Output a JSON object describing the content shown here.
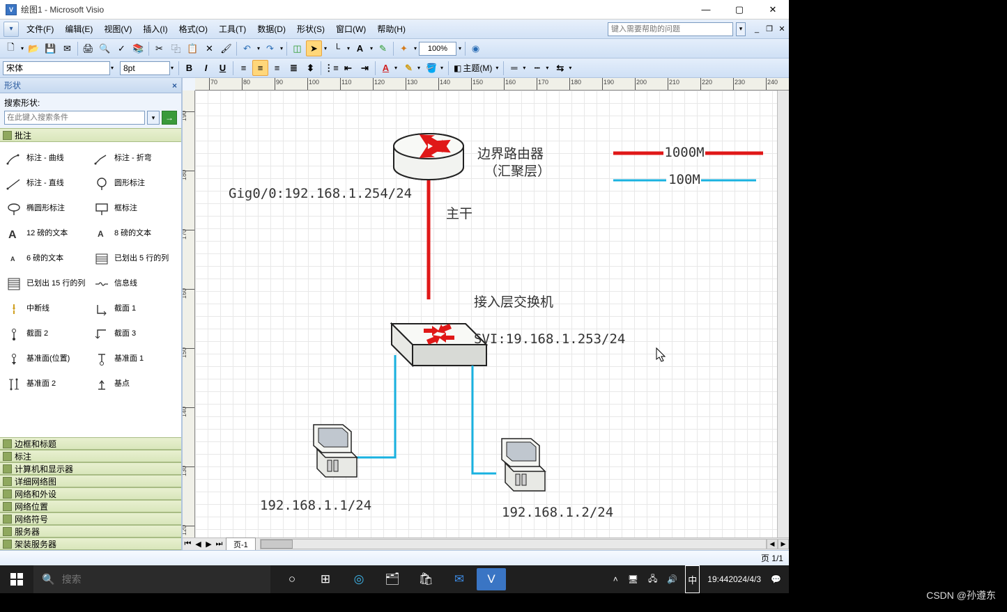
{
  "window": {
    "title": "绘图1 - Microsoft Visio",
    "min": "—",
    "max": "▢",
    "close": "✕"
  },
  "menu": {
    "items": [
      "文件(F)",
      "编辑(E)",
      "视图(V)",
      "插入(I)",
      "格式(O)",
      "工具(T)",
      "数据(D)",
      "形状(S)",
      "窗口(W)",
      "帮助(H)"
    ],
    "help_placeholder": "键入需要帮助的问题"
  },
  "toolbar": {
    "zoom": "100%"
  },
  "format": {
    "font": "宋体",
    "size": "8pt",
    "theme": "主题(M)"
  },
  "shapes_pane": {
    "title": "形状",
    "search_label": "搜索形状:",
    "search_placeholder": "在此键入搜索条件",
    "active_stencil": "批注",
    "items": [
      [
        "标注 - 曲线",
        "标注 - 折弯"
      ],
      [
        "标注 - 直线",
        "圆形标注"
      ],
      [
        "椭圆形标注",
        "框标注"
      ],
      [
        "12 磅的文本",
        "8 磅的文本"
      ],
      [
        "6 磅的文本",
        "已划出 5 行的列"
      ],
      [
        "已划出 15 行的列",
        "信息线"
      ],
      [
        "中断线",
        "截面 1"
      ],
      [
        "截面 2",
        "截面 3"
      ],
      [
        "基准面(位置)",
        "基准面 1"
      ],
      [
        "基准面 2",
        "基点"
      ]
    ],
    "stencil_list": [
      "边框和标题",
      "标注",
      "计算机和显示器",
      "详细网络图",
      "网络和外设",
      "网络位置",
      "网络符号",
      "服务器",
      "架装服务器"
    ]
  },
  "canvas": {
    "h_ticks": [
      70,
      80,
      90,
      100,
      110,
      120,
      130,
      140,
      150,
      160,
      170,
      180,
      190,
      200,
      210,
      220,
      230,
      240
    ],
    "v_ticks": [
      190,
      180,
      170,
      160,
      150,
      140,
      130,
      120
    ],
    "page_tab": "页-1"
  },
  "diagram": {
    "router_label1": "边界路由器",
    "router_label2": "（汇聚层）",
    "gig_label": "Gig0/0:192.168.1.254/24",
    "trunk_label": "主干",
    "switch_label": "接入层交换机",
    "svi_label": "SVI:19.168.1.253/24",
    "pc1_ip": "192.168.1.1/24",
    "pc2_ip": "192.168.1.2/24",
    "legend_1000": "1000M",
    "legend_100": "100M"
  },
  "status": {
    "pages": "页 1/1"
  },
  "taskbar": {
    "search_placeholder": "搜索",
    "ime": "中",
    "time": "19:44",
    "date": "2024/4/3"
  },
  "watermark": "CSDN @孙遵东"
}
